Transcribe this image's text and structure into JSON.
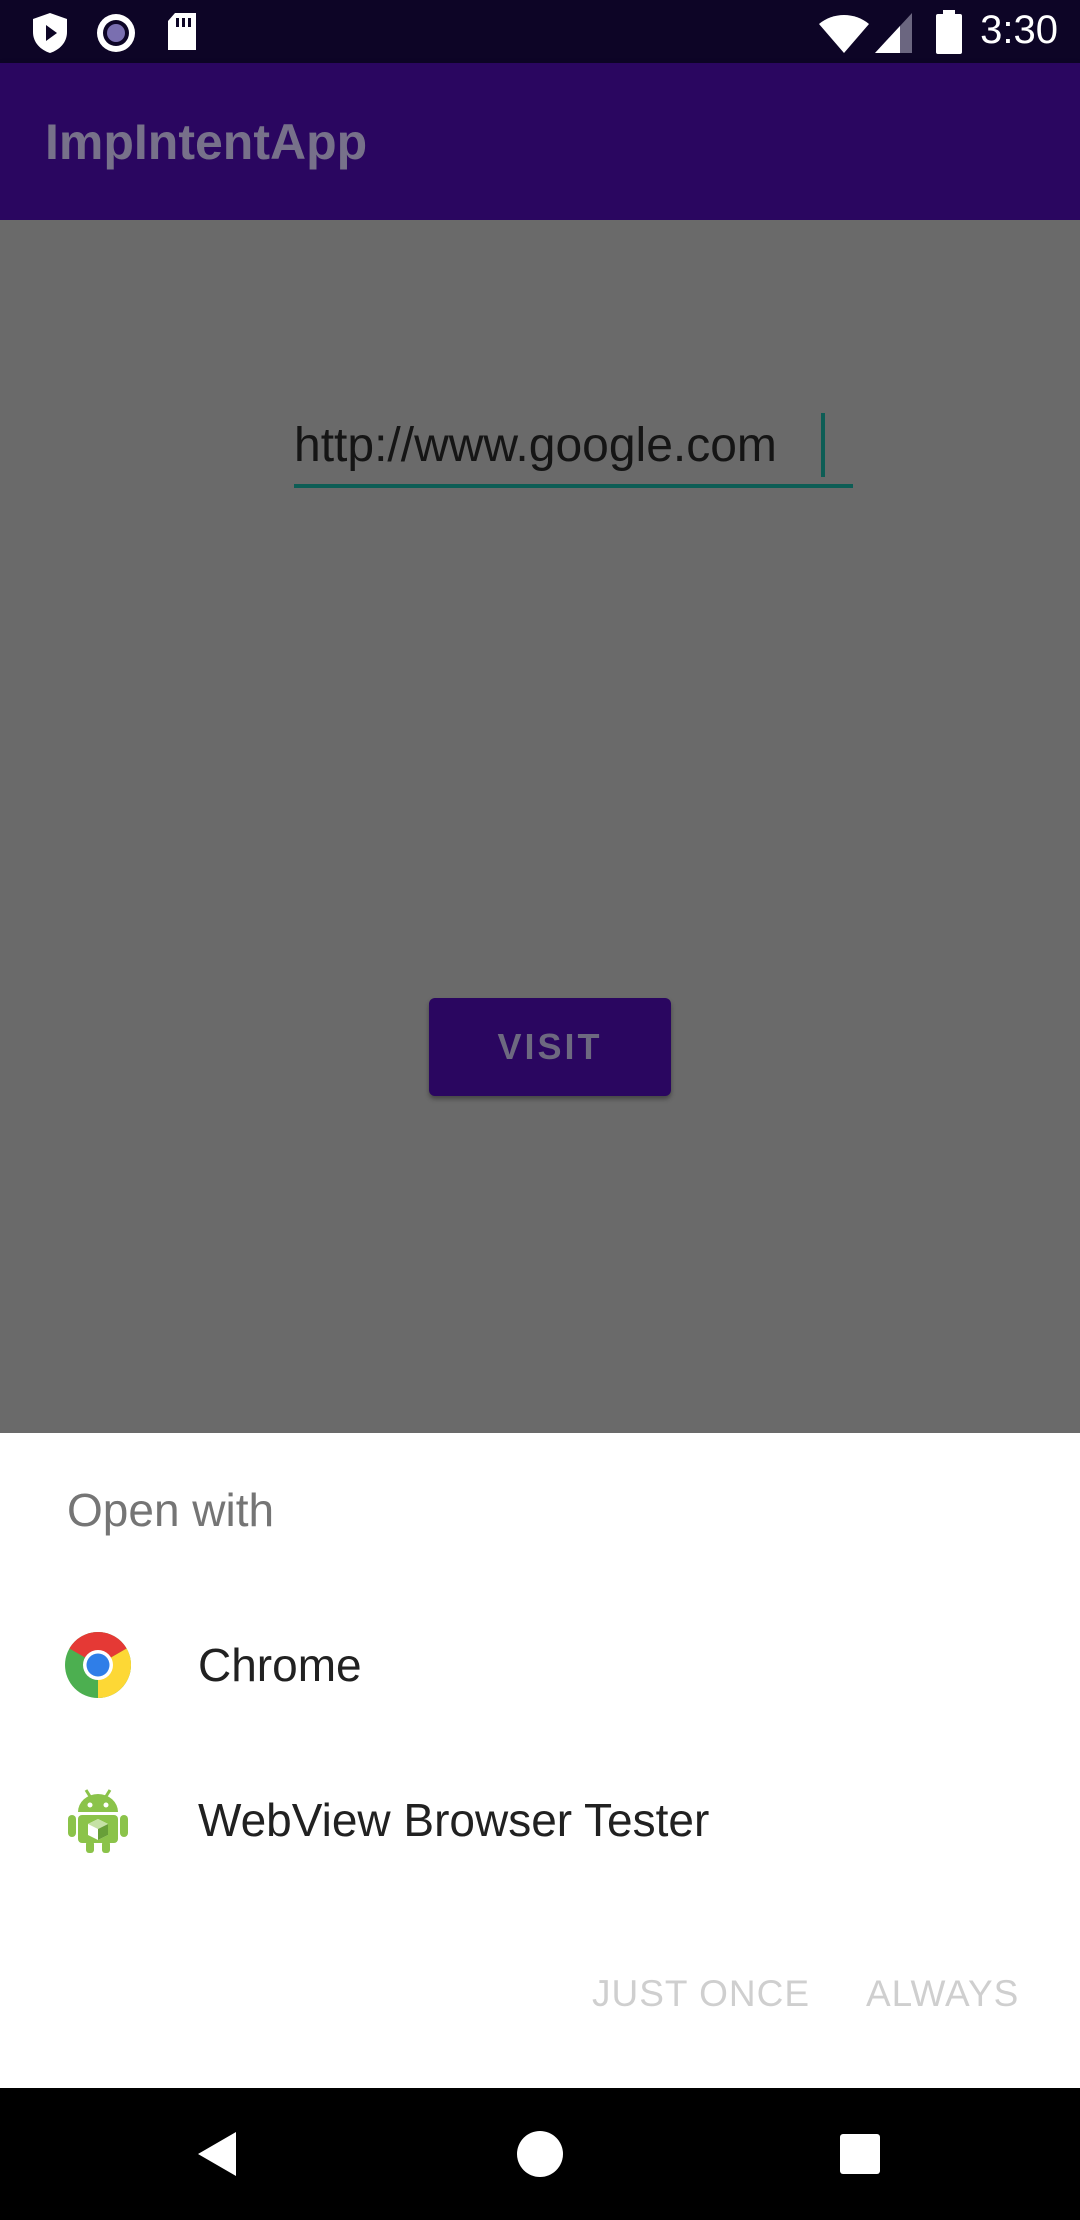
{
  "status_bar": {
    "time": "3:30",
    "left_icons": [
      "shield-play-icon",
      "record-circle-icon",
      "sd-card-icon"
    ],
    "right_icons": [
      "wifi-icon",
      "cell-signal-icon",
      "battery-icon"
    ]
  },
  "app_bar": {
    "title": "ImpIntentApp"
  },
  "main": {
    "url_input_value": "http://www.google.com",
    "visit_label": "VISIT"
  },
  "chooser": {
    "title": "Open with",
    "apps": [
      {
        "label": "Chrome",
        "icon": "chrome-icon"
      },
      {
        "label": "WebView Browser Tester",
        "icon": "android-webview-icon"
      }
    ],
    "just_once_label": "JUST ONCE",
    "always_label": "ALWAYS"
  },
  "nav_bar": {
    "buttons": [
      "back-icon",
      "home-icon",
      "recents-icon"
    ]
  },
  "colors": {
    "app_bar": "#2a0660",
    "status_bar": "#0d0526",
    "scrim": "#6a6a6a",
    "accent": "#0d5d55"
  }
}
